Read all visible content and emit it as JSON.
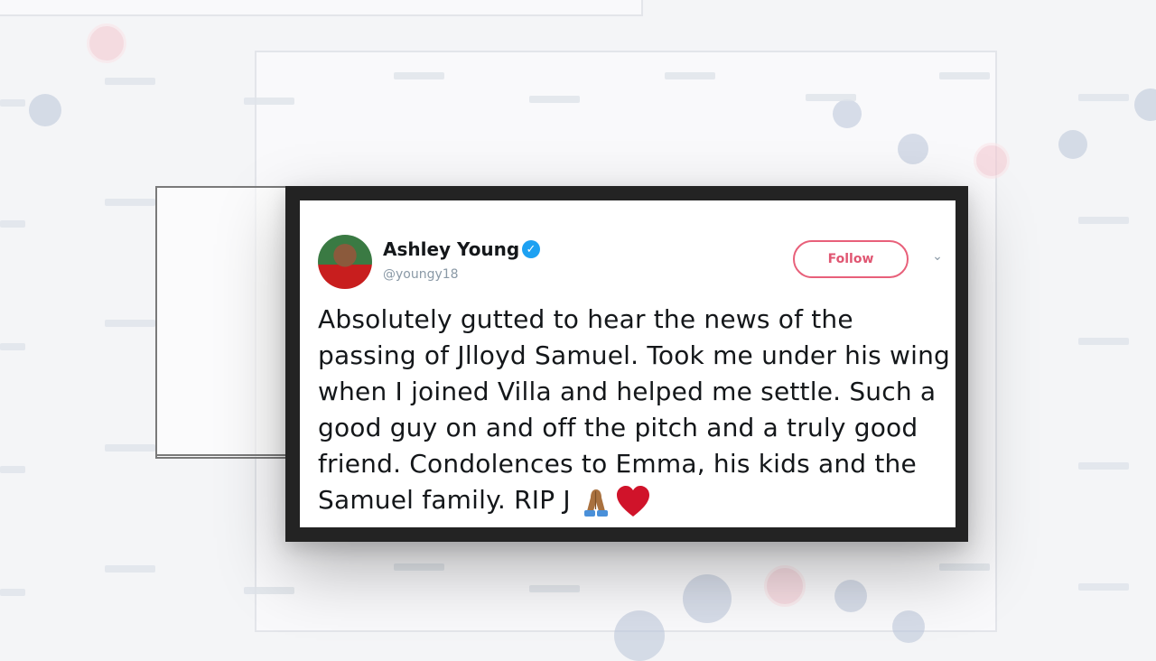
{
  "tweet": {
    "author_name": "Ashley Young",
    "author_handle": "@youngy18",
    "follow_label": "Follow",
    "text": "Absolutely gutted to hear the news of the passing of Jlloyd Samuel. Took me under his wing when I joined Villa and helped me settle. Such a good guy on and off the pitch and a truly good friend. Condolences to Emma, his kids and the Samuel family. RIP J",
    "emoji": [
      "pray-icon",
      "heart-icon"
    ]
  },
  "icons": {
    "verified": "verified-badge-icon",
    "menu": "chevron-down-icon"
  },
  "colors": {
    "frame": "#232323",
    "follow_accent": "#e8607a",
    "verified": "#1da1f2",
    "heart": "#d0132a"
  }
}
